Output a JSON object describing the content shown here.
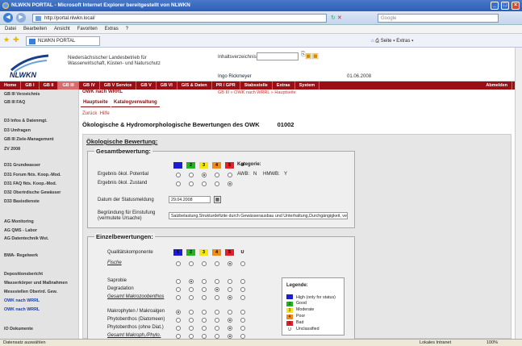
{
  "window": {
    "title": "NLWKN PORTAL - Microsoft Internet Explorer bereitgestellt von NLWKN",
    "url": "http://portal.nlwkn.local/",
    "search_placeholder": "Google"
  },
  "menubar": [
    "Datei",
    "Bearbeiten",
    "Ansicht",
    "Favoriten",
    "Extras",
    "?"
  ],
  "favbar": {
    "tab": "NLWKN PORTAL",
    "tools": "Seite ▾   Extras ▾"
  },
  "header": {
    "org_line1": "Niedersächsischer Landesbetrieb für",
    "org_line2": "Wasserwirtschaft, Küsten- und Naturschutz",
    "logo_text": "NLWKN",
    "search_label": "Inhaltsverzeichnis",
    "user": "Ingo Rickmeyer",
    "date": "01.06.2008"
  },
  "topnav": [
    "Home",
    "GB I",
    "GB II",
    "GB III",
    "GB IV",
    "GB V Service",
    "GB V",
    "GB VI",
    "GIS & Daten",
    "PR / GPR",
    "Stabsstelle",
    "Extras",
    "System"
  ],
  "topnav_active": "GB III",
  "logout": "Abmelden",
  "sidebar": [
    "GB III Verzeichnis",
    "GB III FAQ",
    "D3 Infos & Datenmgt.",
    "D3 Umfragen",
    "GB III Ziele-Management",
    "ZV 2008",
    "D31 Grundwasser",
    "D31 Forum fkts. Koop.-Mod.",
    "D31 FAQ fkts. Koop.-Mod.",
    "D32 Oberirdische Gewässer",
    "D33 Basisdienste",
    "AG Monitoring",
    "AG QMS - Labor",
    "AG Datentechnik Wst.",
    "BWA- Regelwerk",
    "Depositionsbericht",
    "Wasserkörper und Maßnahmen",
    "Messstellen Oberird. Gew.",
    "OWK nach WRRL",
    "OWK nach WRRL",
    "IO Dokumente"
  ],
  "content": {
    "subnav": "OWK nach WRRL",
    "breadcrumb": "GB III  »  OWK nach WRRL  »  Hauptseite",
    "tabs": [
      "Hauptseite",
      "Katalogverwaltung"
    ],
    "back": "Zurück",
    "help": "Hilfe",
    "title": "Ökologische & Hydromorphologische Bewertungen des OWK",
    "owk_id": "01002",
    "section_heading": "Ökologische Bewertung:"
  },
  "gesamt": {
    "legend": "Gesamtbewertung:",
    "classes": [
      "",
      "2",
      "3",
      "4",
      "5",
      "U"
    ],
    "colors": [
      "#1c1cd8",
      "#22b222",
      "#f2e61a",
      "#f28a1a",
      "#e0202a"
    ],
    "rows": [
      {
        "label": "Ergebnis ökol. Potential",
        "selected": 3
      },
      {
        "label": "Ergebnis ökol. Zustand",
        "selected": 5
      }
    ],
    "kategorie_label": "Kategorie:",
    "awb": "AWB:",
    "awb_val": "N",
    "hmwb": "HMWB:",
    "hmwb_val": "Y",
    "datum_label": "Datum der Statusmeldung",
    "datum_value": "29.04.2008",
    "begr_label1": "Begründung für Einstufung",
    "begr_label2": "(vermutete Ursache)",
    "begr_value": "Salzbelastung,Strukturdefizite durch Gewässerausbau und Unterhaltung,Durchgängigkeit, ve"
  },
  "einzel": {
    "legend": "Einzelbewertungen:",
    "header_label": "Qualitätskomponente",
    "classes": [
      "1",
      "2",
      "3",
      "4",
      "5",
      "U"
    ],
    "rows": [
      {
        "label": "Fische",
        "u": true,
        "selected": 5
      },
      {
        "label": "Saprobie",
        "u": false,
        "selected": 2
      },
      {
        "label": "Degradation",
        "u": false,
        "selected": 4
      },
      {
        "label": "Gesamt Makrozoobenthos",
        "u": true,
        "selected": 5
      },
      {
        "label": "Makrophyten / Makroalgen",
        "u": false,
        "selected": 1
      },
      {
        "label": "Phytobenthos (Diatomeen)",
        "u": false,
        "selected": 5
      },
      {
        "label": "Phytobenthos (ohne Diat.)",
        "u": false,
        "selected": 5
      },
      {
        "label": "Gesamt Makroph./Phyto.",
        "u": true,
        "selected": 5
      }
    ]
  },
  "legend": {
    "title": "Legende:",
    "items": [
      {
        "code": "",
        "label": "High (only for status)",
        "color": "#1c1cd8"
      },
      {
        "code": "2",
        "label": "Good",
        "color": "#22b222"
      },
      {
        "code": "3",
        "label": "Moderate",
        "color": "#f2e61a"
      },
      {
        "code": "4",
        "label": "Poor",
        "color": "#f28a1a"
      },
      {
        "code": "5",
        "label": "Bad",
        "color": "#e0202a"
      },
      {
        "code": "U",
        "label": "Unclassified",
        "color": ""
      }
    ]
  },
  "status": {
    "left": "Datensatz auswählen",
    "zone": "Lokales Intranet",
    "zoom": "100%"
  }
}
